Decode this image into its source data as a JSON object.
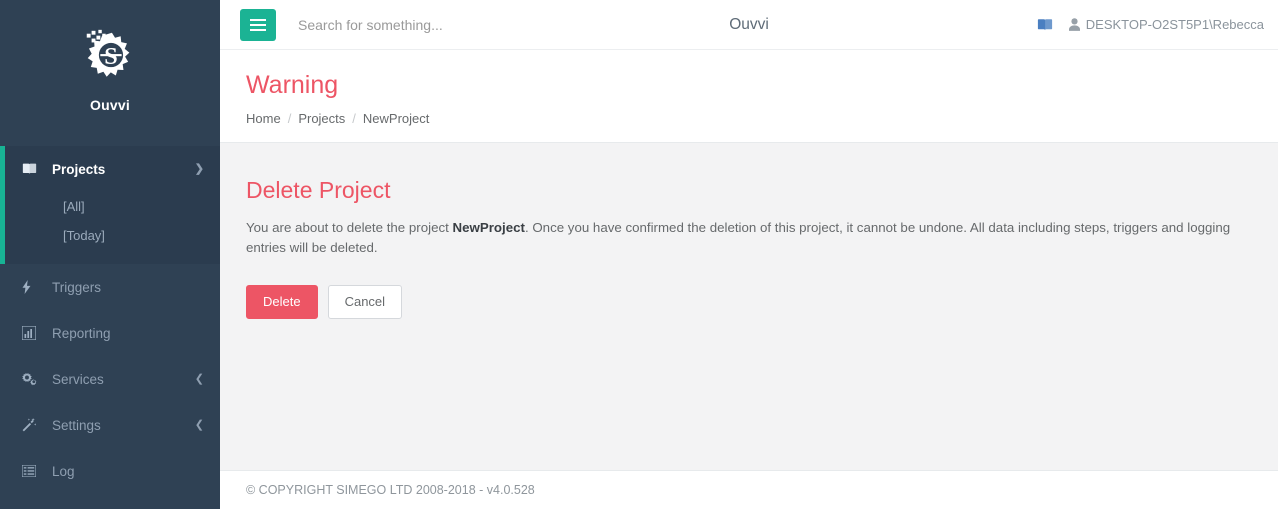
{
  "brand": {
    "name": "Ouvvi",
    "logo_icon": "gear-s-logo-icon"
  },
  "sidebar": {
    "groups": [
      {
        "label": "Projects",
        "icon": "book-icon",
        "caret_icon": "chevron-down-icon",
        "active": true,
        "subitems": [
          {
            "label": "[All]"
          },
          {
            "label": "[Today]"
          }
        ]
      },
      {
        "label": "Triggers",
        "icon": "bolt-icon",
        "caret_icon": "",
        "active": false,
        "subitems": []
      },
      {
        "label": "Reporting",
        "icon": "chart-bar-icon",
        "caret_icon": "",
        "active": false,
        "subitems": []
      },
      {
        "label": "Services",
        "icon": "gears-icon",
        "caret_icon": "chevron-left-icon",
        "active": false,
        "subitems": []
      },
      {
        "label": "Settings",
        "icon": "magic-wand-icon",
        "caret_icon": "chevron-left-icon",
        "active": false,
        "subitems": []
      },
      {
        "label": "Log",
        "icon": "list-icon",
        "caret_icon": "",
        "active": false,
        "subitems": []
      }
    ]
  },
  "topbar": {
    "menu_button_icon": "hamburger-icon",
    "search_placeholder": "Search for something...",
    "search_value": "",
    "title": "Ouvvi",
    "book_icon": "book-icon",
    "user_icon": "user-icon",
    "user_name": "DESKTOP-O2ST5P1\\Rebecca"
  },
  "pageheader": {
    "title": "Warning",
    "breadcrumb": [
      {
        "label": "Home",
        "link": true
      },
      {
        "label": "Projects",
        "link": true
      },
      {
        "label": "NewProject",
        "link": false
      }
    ],
    "separator": "/"
  },
  "content": {
    "section_title": "Delete Project",
    "text_before": "You are about to delete the project ",
    "project_name": "NewProject",
    "text_after": ". Once you have confirmed the deletion of this project, it cannot be undone. All data including steps, triggers and logging entries will be deleted.",
    "delete_label": "Delete",
    "cancel_label": "Cancel"
  },
  "footer": {
    "text": "© COPYRIGHT SIMEGO LTD 2008-2018 - v4.0.528"
  },
  "colors": {
    "accent_green": "#1bb394",
    "sidebar_bg": "#2f4154",
    "sidebar_active_bg": "#2b3c4f",
    "danger_red": "#ed5565",
    "content_bg": "#f3f3f4"
  }
}
